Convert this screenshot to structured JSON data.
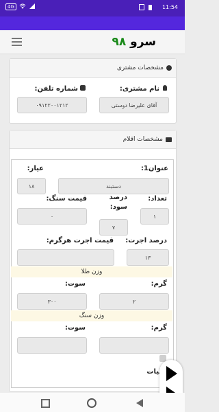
{
  "status": {
    "time": "11:54",
    "network": "4G"
  },
  "app": {
    "brand_text": "سرو",
    "brand_num": "۹۸"
  },
  "customer_card": {
    "title": "مشخصات مشتری",
    "name_label": "نام مشتری:",
    "name_value": "آقای علیرضا دوستی",
    "phone_label": "شماره تلفن:",
    "phone_value": "۰۹۱۲۲۰۰۱۲۱۲"
  },
  "items_card": {
    "title": "مشخصات اقلام",
    "title_label": "عنوان1:",
    "title_value": "دستبند",
    "ayar_label": "عیار:",
    "ayar_value": "۱۸",
    "count_label": "تعداد:",
    "count_value": "۱",
    "profit_label": "درصد سود:",
    "profit_value": "۷",
    "stone_price_label": "قیمت سنگ:",
    "stone_price_value": "۰",
    "wage_percent_label": "درصد اجرت:",
    "wage_percent_value": "۱۳",
    "wage_per_gram_label": "قیمت اجرت هرگرم:",
    "wage_per_gram_value": "",
    "gold_weight_heading": "وزن طلا",
    "gram_label": "گرم:",
    "gold_gram_value": "۲",
    "sot_label": "سوت:",
    "gold_sot_value": "۳۰۰",
    "stone_weight_heading": "وزن سنگ",
    "stone_gram_value": "",
    "stone_sot_value": "",
    "tax_label": "مالیات"
  }
}
